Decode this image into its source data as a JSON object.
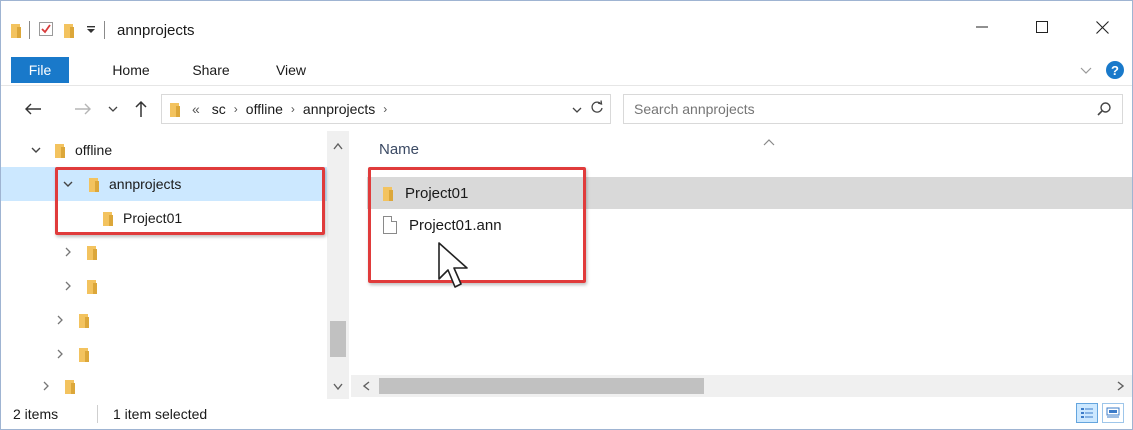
{
  "window": {
    "title": "annprojects",
    "controls": {
      "minimize": "—",
      "maximize": "☐",
      "close": "✕"
    }
  },
  "ribbon": {
    "tabs": [
      "File",
      "Home",
      "Share",
      "View"
    ],
    "help": "?"
  },
  "navigation": {
    "back": "←",
    "forward": "→",
    "recent": "⌄",
    "up": "↑",
    "overflow": "«",
    "breadcrumb": [
      "sc",
      "offline",
      "annprojects"
    ],
    "crumb_separator": "›",
    "dropdown": "⌄",
    "refresh": "↻"
  },
  "search": {
    "placeholder": "Search annprojects"
  },
  "tree": {
    "items": [
      {
        "label": "offline",
        "chevron": "⌄"
      },
      {
        "label": "annprojects",
        "chevron": "⌄",
        "selected": true
      },
      {
        "label": "Project01",
        "chevron": ""
      },
      {
        "label": "",
        "chevron": "›"
      },
      {
        "label": "",
        "chevron": "›"
      },
      {
        "label": "",
        "chevron": "›"
      },
      {
        "label": "",
        "chevron": "›"
      },
      {
        "label": "",
        "chevron": "›"
      }
    ]
  },
  "files": {
    "column_name": "Name",
    "sort_indicator": "^",
    "items": [
      {
        "name": "Project01",
        "type": "folder"
      },
      {
        "name": "Project01.ann",
        "type": "file"
      }
    ]
  },
  "status": {
    "item_count": "2 items",
    "selection": "1 item selected"
  },
  "colors": {
    "accent": "#1979ca",
    "selection": "#cce8ff",
    "highlight": "#e03b3b",
    "folder": "#f3c35f"
  }
}
